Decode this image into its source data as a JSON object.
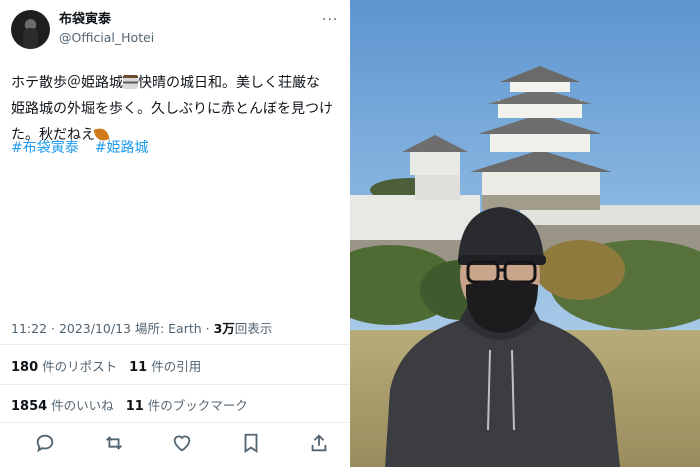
{
  "tweet": {
    "display_name": "布袋寅泰",
    "handle": "@Official_Hotei",
    "more_label": "···",
    "text_line1_a": "ホテ散歩＠姫路城",
    "text_line1_b": "快晴の城日和。美しく荘厳な",
    "text_line2": "姫路城の外堀を歩く。久しぶりに赤とんぼを見つけ",
    "text_line3": "た。秋だねえ",
    "hashtags": [
      "#布袋寅泰",
      "#姫路城"
    ],
    "meta": {
      "time": "11:22 · 2023/10/13 場所: Earth · ",
      "views_count": "3万",
      "views_label": "回表示"
    },
    "stats": {
      "reposts_count": "180",
      "reposts_label": "件のリポスト",
      "quotes_count": "11",
      "quotes_label": "件の引用",
      "likes_count": "1854",
      "likes_label": "件のいいね",
      "bookmarks_count": "11",
      "bookmarks_label": "件のブックマーク"
    },
    "actions": [
      "reply-icon",
      "repost-icon",
      "like-icon",
      "bookmark-icon",
      "share-icon"
    ]
  },
  "colors": {
    "link": "#1d9bf0",
    "secondary_text": "#536471",
    "sky": "#6fa3d8"
  }
}
